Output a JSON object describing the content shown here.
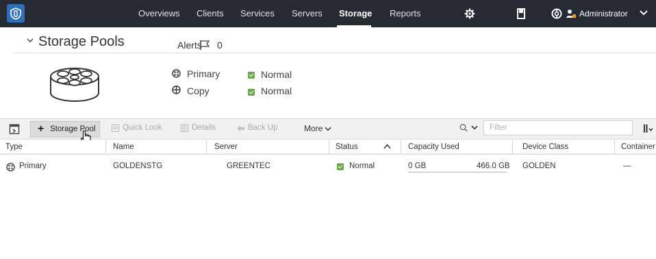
{
  "nav": {
    "items": [
      {
        "label": "Overviews",
        "active": false
      },
      {
        "label": "Clients",
        "active": false
      },
      {
        "label": "Services",
        "active": false
      },
      {
        "label": "Servers",
        "active": false
      },
      {
        "label": "Storage",
        "active": true
      },
      {
        "label": "Reports",
        "active": false
      }
    ],
    "user": "Administrator",
    "icons": [
      "settings-icon",
      "notebook-icon",
      "help-icon",
      "user-icon",
      "chevron-down-icon"
    ]
  },
  "header": {
    "title": "Storage Pools",
    "alerts_label": "Alerts",
    "alerts_count": "0"
  },
  "summary": [
    {
      "type": "Primary",
      "status": "Normal"
    },
    {
      "type": "Copy",
      "status": "Normal"
    }
  ],
  "toolbar": {
    "add_label": "Storage Pool",
    "quick_look": "Quick Look",
    "details": "Details",
    "back_up": "Back Up",
    "more": "More",
    "filter_placeholder": "Filter"
  },
  "table": {
    "columns": [
      "Type",
      "Name",
      "Server",
      "Status",
      "Capacity Used",
      "Device Class",
      "Container T"
    ],
    "rows": [
      {
        "type": "Primary",
        "name": "GOLDENSTG",
        "server": "GREENTEC",
        "status": "Normal",
        "capacity_used": "0 GB",
        "capacity_total": "466.0 GB",
        "device_class": "GOLDEN",
        "container": "—"
      }
    ]
  },
  "colors": {
    "topbar": "#262a33",
    "logo": "#2f6fb6",
    "status_normal": "#6aa84f",
    "admin_accent": "#e8a21a"
  }
}
